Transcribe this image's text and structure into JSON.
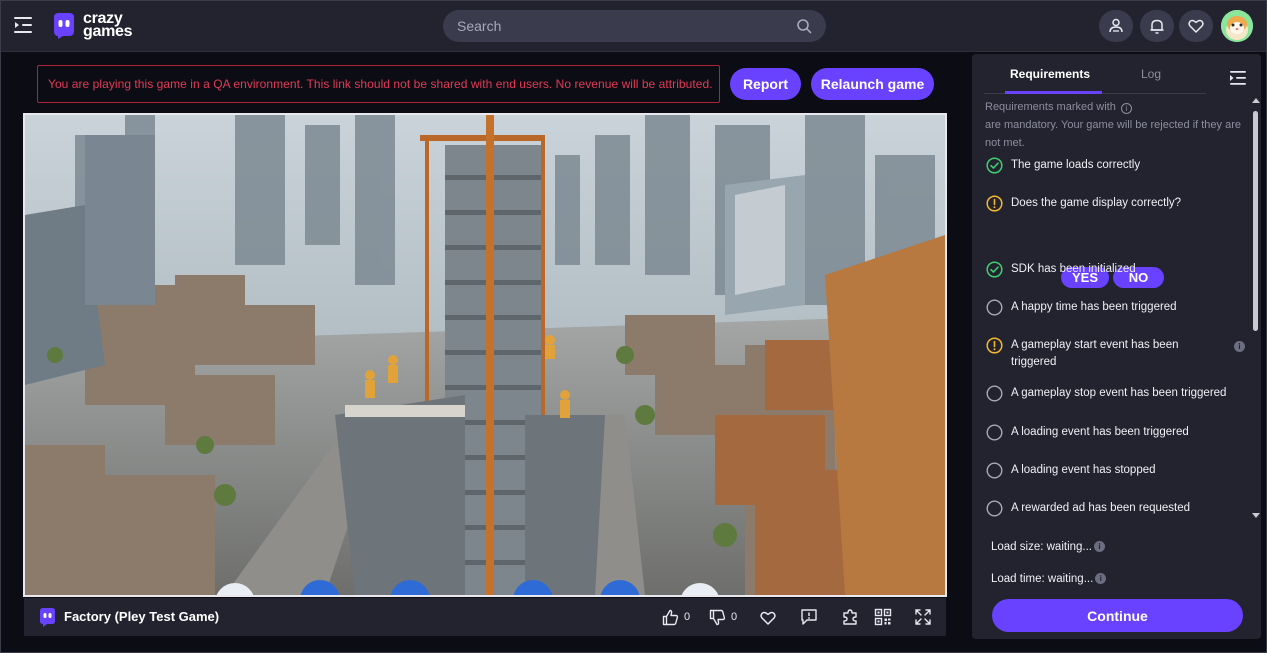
{
  "header": {
    "logo_text_line1": "crazy",
    "logo_text_line2": "games",
    "search_placeholder": "Search",
    "icons": [
      "menu-icon",
      "search-icon",
      "friends-icon",
      "bell-icon",
      "heart-icon",
      "avatar"
    ]
  },
  "qa_banner": {
    "message": "You are playing this game in a QA environment. This link should not be shared with end users. No revenue will be attributed."
  },
  "actions": {
    "report_label": "Report",
    "relaunch_label": "Relaunch game"
  },
  "game": {
    "title": "Factory (Pley Test Game)",
    "likes": "0",
    "dislikes": "0"
  },
  "panel": {
    "tabs": [
      {
        "label": "Requirements",
        "active": true
      },
      {
        "label": "Log",
        "active": false
      }
    ],
    "note_part1": "Requirements marked with",
    "note_part2": "are mandatory. Your game will be rejected if they are not met.",
    "requirements": [
      {
        "label": "The game loads correctly",
        "status": "passed"
      },
      {
        "label": "Does the game display correctly?",
        "status": "warning"
      },
      {
        "label": "SDK has been initialized",
        "status": "passed"
      },
      {
        "label": "A happy time has been triggered",
        "status": "pending"
      },
      {
        "label": "A gameplay start event has been triggered",
        "status": "warning"
      },
      {
        "label": "A gameplay stop event has been triggered",
        "status": "pending"
      },
      {
        "label": "A loading event has been triggered",
        "status": "pending"
      },
      {
        "label": "A loading event has stopped",
        "status": "pending"
      },
      {
        "label": "A rewarded ad has been requested",
        "status": "pending"
      }
    ],
    "yes_label": "YES",
    "no_label": "NO",
    "load_size": "Load size: waiting...",
    "load_time": "Load time: waiting...",
    "continue_label": "Continue"
  },
  "colors": {
    "accent": "#6842ff",
    "passed": "#3fcf6f",
    "warning": "#f5b82e",
    "danger": "#e23a56"
  }
}
